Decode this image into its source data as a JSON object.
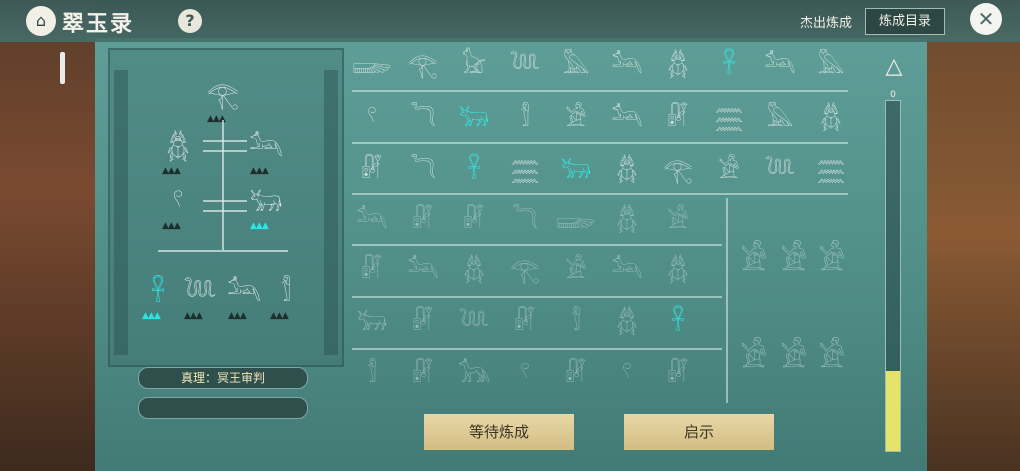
{
  "header": {
    "title": "翠玉录",
    "help_label": "?",
    "excellent_link": "杰出炼成",
    "catalog_button": "炼成目录",
    "close_label": "✕"
  },
  "tree": {
    "truth_label": "真理：冥王审判",
    "nodes": [
      {
        "glyph": "𓂀",
        "name": "eye-of-horus"
      },
      {
        "glyph": "𓆣",
        "name": "feathers"
      },
      {
        "glyph": "𓃢",
        "name": "jackal"
      },
      {
        "glyph": "𓍢",
        "name": "ring"
      },
      {
        "glyph": "𓃒",
        "name": "bull"
      },
      {
        "glyph": "𓋹",
        "name": "crook-flail"
      },
      {
        "glyph": "𓆙",
        "name": "serpent"
      },
      {
        "glyph": "𓃢",
        "name": "anubis"
      },
      {
        "glyph": "𓀾",
        "name": "mummy"
      }
    ]
  },
  "grid": {
    "rows": [
      [
        "𓆃",
        "𓂀",
        "𓃠",
        "𓆙",
        "𓅓",
        "𓃢",
        "𓆣",
        "𓋹",
        "𓃢",
        "𓅓"
      ],
      [
        "𓍢",
        "𓆓",
        "𓃒",
        "𓀾",
        "𓀀",
        "𓃢",
        "𓏞",
        "𓈗",
        "𓅓",
        "𓆣"
      ],
      [
        "𓏞",
        "𓆓",
        "𓋹",
        "𓈗",
        "𓃒",
        "𓆣",
        "𓂀",
        "𓀀",
        "𓆙",
        "𓈗"
      ],
      [
        "𓃢",
        "𓏞",
        "𓏞",
        "𓆓",
        "𓆃",
        "𓆣",
        "𓀀"
      ],
      [
        "𓏞",
        "𓃢",
        "𓆣",
        "𓂀",
        "𓀀",
        "𓃢",
        "𓆣"
      ],
      [
        "𓃒",
        "𓏞",
        "𓆙",
        "𓏞",
        "𓀾",
        "𓆣",
        "𓋹"
      ],
      [
        "𓀾",
        "𓏞",
        "𓃥",
        "𓍢",
        "𓏞",
        "𓍢",
        "𓏞"
      ]
    ],
    "highlighted": [
      [
        0,
        7
      ],
      [
        1,
        2
      ],
      [
        2,
        2
      ],
      [
        2,
        4
      ],
      [
        5,
        6
      ]
    ]
  },
  "gauge": {
    "label": "0",
    "level": 0.23
  },
  "buttons": {
    "wait_label": "等待炼成",
    "hint_label": "启示"
  },
  "colors": {
    "highlight": "#2ef3f0",
    "panel": "#5f9e98",
    "button": "#e0cc95"
  }
}
